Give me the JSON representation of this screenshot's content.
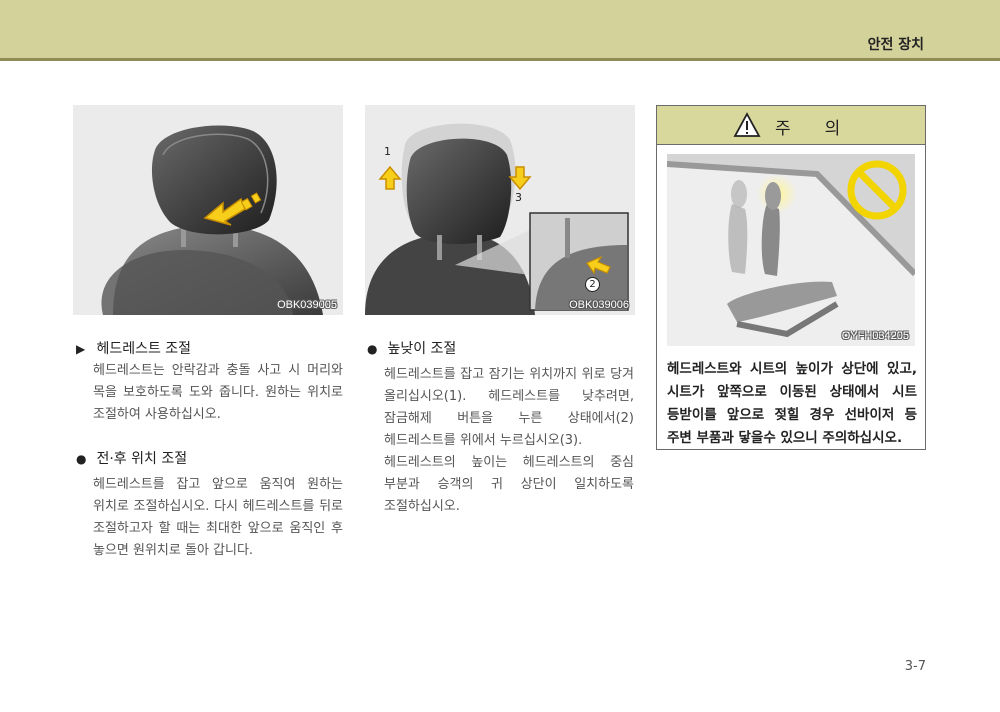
{
  "header": {
    "section_title": "안전 장치"
  },
  "photos": {
    "photo1_code": "OBK039005",
    "photo2_code": "OBK039006",
    "photo2_callouts": [
      "1",
      "3",
      "2"
    ]
  },
  "left": {
    "s1": {
      "marker": "▶",
      "title": "헤드레스트 조절",
      "body": "헤드레스트는 안락감과 충돌 사고 시 머리와 목을 보호하도록 도와 줍니다. 원하는 위치로 조절하여 사용하십시오."
    },
    "s2": {
      "marker": "●",
      "title": "전·후 위치 조절",
      "body": "헤드레스트를 잡고 앞으로 움직여 원하는 위치로 조절하십시오. 다시 헤드레스트를 뒤로 조절하고자 할 때는 최대한 앞으로 움직인 후 놓으면 원위치로 돌아 갑니다."
    }
  },
  "middle": {
    "s3": {
      "marker": "●",
      "title": "높낮이 조절",
      "body1": "헤드레스트를 잡고 잠기는 위치까지 위로 당겨 올리십시오(1). 헤드레스트를 낮추려면, 잠금해제 버튼을 누른 상태에서(2) 헤드레스트를 위에서 누르십시오(3).",
      "body2": "헤드레스트의 높이는 헤드레스트의 중심 부분과 승객의 귀 상단이 일치하도록 조절하십시오."
    }
  },
  "caution": {
    "title": "주의",
    "photo_code": "OYFH034205",
    "text": "헤드레스트와 시트의 높이가 상단에 있고, 시트가 앞쪽으로 이동된 상태에서 시트 등받이를 앞으로 젖힐 경우 선바이저 등 주변 부품과 닿을수 있으니 주의하십시오."
  },
  "footer": {
    "page_number": "3-7"
  }
}
